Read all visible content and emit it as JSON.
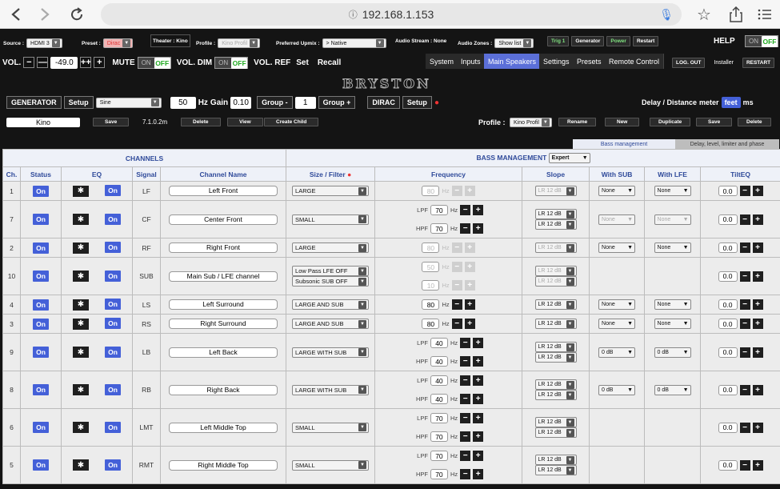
{
  "browser": {
    "url": "192.168.1.153"
  },
  "top": {
    "source_label": "Source :",
    "source_value": "HDMI 3",
    "preset_label": "Preset :",
    "preset_value": "Dirac",
    "theater_label": "Theater : Kino",
    "profile_label": "Profile :",
    "profile_value": "Kino Profil",
    "upmix_label": "Preferred Upmix :",
    "upmix_value": "> Native",
    "audio_stream": "Audio Stream : None",
    "audio_zones_label": "Audio Zones :",
    "audio_zones_value": "Show list",
    "trig": "Trig 1",
    "generator": "Generator",
    "power": "Power",
    "restart": "Restart",
    "help": "HELP",
    "help_on": "ON",
    "help_off": "OFF"
  },
  "vol": {
    "label": "VOL.",
    "minus": "−",
    "minus2": "—",
    "value": "-49.0",
    "plus2": "++",
    "plus": "+",
    "mute": "MUTE",
    "on": "ON",
    "off": "OFF",
    "dim": "VOL. DIM",
    "ref": "VOL. REF",
    "set": "Set",
    "recall": "Recall"
  },
  "tabs": [
    "System",
    "Inputs",
    "Main Speakers",
    "Settings",
    "Presets",
    "Remote Control"
  ],
  "tab_right": {
    "logout": "LOG. OUT",
    "installer": "Installer",
    "restart": "RESTART"
  },
  "logo": "BRYSTON",
  "gen": {
    "generator": "GENERATOR",
    "setup": "Setup",
    "wave": "Sine",
    "freq": "50",
    "hz": "Hz",
    "gain_label": "Gain",
    "gain": "0.10",
    "group_minus": "Group -",
    "group": "1",
    "group_plus": "Group +",
    "dirac": "DIRAC",
    "dirac_setup": "Setup",
    "delay": "Delay / Distance",
    "meter": "meter",
    "feet": "feet",
    "ms": "ms"
  },
  "sub": {
    "name": "Kino",
    "save": "Save",
    "version": "7.1.0.2m",
    "delete": "Delete",
    "view": "View",
    "create": "Create Child",
    "profile_label": "Profile :",
    "profile_value": "Kino Profil",
    "rename": "Rename",
    "new": "New",
    "duplicate": "Duplicate",
    "save2": "Save",
    "delete2": "Delete"
  },
  "subtabs": [
    "Bass management",
    "Delay, level, limiter and phase"
  ],
  "table": {
    "group_channels": "CHANNELS",
    "group_bass": "BASS MANAGEMENT",
    "bass_mode": "Expert",
    "headers": {
      "ch": "Ch.",
      "status": "Status",
      "eq": "EQ",
      "signal": "Signal",
      "name": "Channel Name",
      "size": "Size / Filter",
      "freq": "Frequency",
      "slope": "Slope",
      "withsub": "With SUB",
      "withlfe": "With LFE",
      "tilt": "TiltEQ"
    },
    "on": "On",
    "hz": "Hz",
    "lpf": "LPF",
    "hpf": "HPF",
    "minus": "−",
    "plus": "+",
    "rows": [
      {
        "ch": "1",
        "signal": "LF",
        "name": "Left Front",
        "size": "LARGE",
        "f1": "80",
        "slope1": "LR 12 dB",
        "withsub": "None",
        "withlfe": "None",
        "tilt": "0.0"
      },
      {
        "ch": "7",
        "signal": "CF",
        "name": "Center Front",
        "size": "SMALL",
        "lpf": "70",
        "hpf": "70",
        "slope1": "LR 12 dB",
        "slope2": "LR 12 dB",
        "withsub": "None",
        "withlfe": "None",
        "tilt": "0.0"
      },
      {
        "ch": "2",
        "signal": "RF",
        "name": "Right Front",
        "size": "LARGE",
        "f1": "80",
        "slope1": "LR 12 dB",
        "withsub": "None",
        "withlfe": "None",
        "tilt": "0.0"
      },
      {
        "ch": "10",
        "signal": "SUB",
        "name": "Main Sub / LFE channel",
        "size": "Low Pass LFE OFF",
        "size2": "Subsonic SUB OFF",
        "f1": "50",
        "f2": "10",
        "slope1": "LR 12 dB",
        "slope2": "LR 12 dB",
        "tilt": "0.0"
      },
      {
        "ch": "4",
        "signal": "LS",
        "name": "Left Surround",
        "size": "LARGE AND SUB",
        "f1": "80",
        "slope1": "LR 12 dB",
        "withsub": "None",
        "withlfe": "None",
        "tilt": "0.0"
      },
      {
        "ch": "3",
        "signal": "RS",
        "name": "Right Surround",
        "size": "LARGE AND SUB",
        "f1": "80",
        "slope1": "LR 12 dB",
        "withsub": "None",
        "withlfe": "None",
        "tilt": "0.0"
      },
      {
        "ch": "9",
        "signal": "LB",
        "name": "Left Back",
        "size": "LARGE WITH SUB",
        "lpf": "40",
        "hpf": "40",
        "slope1": "LR 12 dB",
        "slope2": "LR 12 dB",
        "withsub": "0 dB",
        "withlfe": "0 dB",
        "tilt": "0.0"
      },
      {
        "ch": "8",
        "signal": "RB",
        "name": "Right Back",
        "size": "LARGE WITH SUB",
        "lpf": "40",
        "hpf": "40",
        "slope1": "LR 12 dB",
        "slope2": "LR 12 dB",
        "withsub": "0 dB",
        "withlfe": "0 dB",
        "tilt": "0.0"
      },
      {
        "ch": "6",
        "signal": "LMT",
        "name": "Left Middle Top",
        "size": "SMALL",
        "lpf": "70",
        "hpf": "70",
        "slope1": "LR 12 dB",
        "slope2": "LR 12 dB",
        "tilt": "0.0"
      },
      {
        "ch": "5",
        "signal": "RMT",
        "name": "Right Middle Top",
        "size": "SMALL",
        "lpf": "70",
        "hpf": "70",
        "slope1": "LR 12 dB",
        "slope2": "LR 12 dB",
        "tilt": "0.0"
      }
    ]
  }
}
